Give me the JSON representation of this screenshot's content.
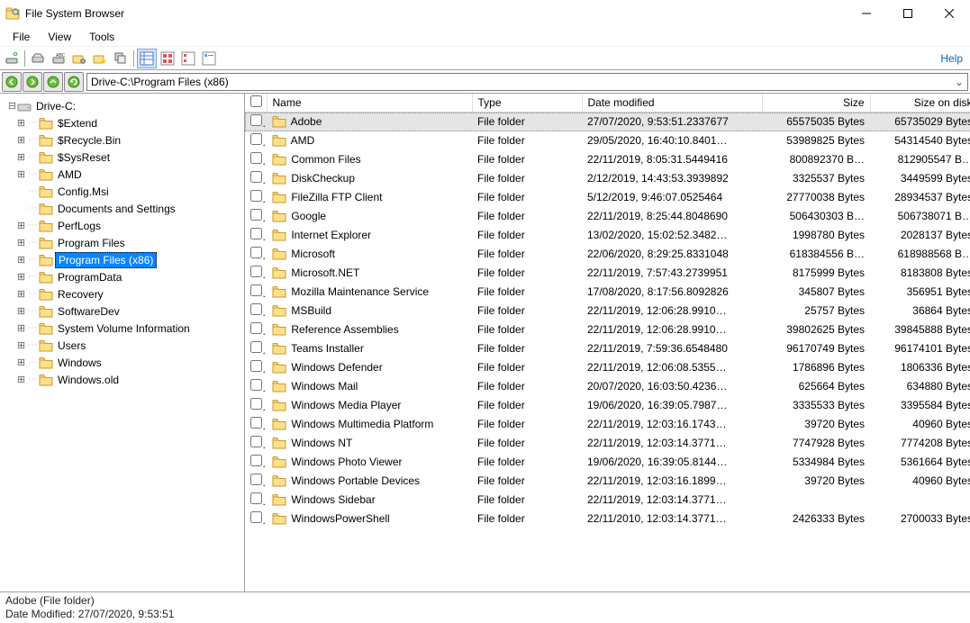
{
  "window": {
    "title": "File System Browser"
  },
  "menubar": [
    "File",
    "View",
    "Tools"
  ],
  "help_label": "Help",
  "path": "Drive-C:\\Program Files (x86)",
  "tree": {
    "root": {
      "label": "Drive-C:",
      "expanded": true,
      "icon": "drive"
    },
    "children": [
      {
        "label": "$Extend",
        "hasChildren": true
      },
      {
        "label": "$Recycle.Bin",
        "hasChildren": true
      },
      {
        "label": "$SysReset",
        "hasChildren": true
      },
      {
        "label": "AMD",
        "hasChildren": true
      },
      {
        "label": "Config.Msi",
        "hasChildren": false
      },
      {
        "label": "Documents and Settings",
        "hasChildren": false
      },
      {
        "label": "PerfLogs",
        "hasChildren": true
      },
      {
        "label": "Program Files",
        "hasChildren": true
      },
      {
        "label": "Program Files (x86)",
        "hasChildren": true,
        "selected": true
      },
      {
        "label": "ProgramData",
        "hasChildren": true
      },
      {
        "label": "Recovery",
        "hasChildren": true
      },
      {
        "label": "SoftwareDev",
        "hasChildren": true
      },
      {
        "label": "System Volume Information",
        "hasChildren": true
      },
      {
        "label": "Users",
        "hasChildren": true
      },
      {
        "label": "Windows",
        "hasChildren": true
      },
      {
        "label": "Windows.old",
        "hasChildren": true
      }
    ]
  },
  "columns": [
    "Name",
    "Type",
    "Date modified",
    "Size",
    "Size on disk"
  ],
  "rows": [
    {
      "name": "Adobe",
      "type": "File folder",
      "date": "27/07/2020, 9:53:51.2337677",
      "size": "65575035 Bytes",
      "disk": "65735029 Bytes",
      "selected": true
    },
    {
      "name": "AMD",
      "type": "File folder",
      "date": "29/05/2020, 16:40:10.8401…",
      "size": "53989825 Bytes",
      "disk": "54314540 Bytes"
    },
    {
      "name": "Common Files",
      "type": "File folder",
      "date": "22/11/2019, 8:05:31.5449416",
      "size": "800892370 B…",
      "disk": "812905547 B…"
    },
    {
      "name": "DiskCheckup",
      "type": "File folder",
      "date": "2/12/2019, 14:43:53.3939892",
      "size": "3325537 Bytes",
      "disk": "3449599 Bytes"
    },
    {
      "name": "FileZilla FTP Client",
      "type": "File folder",
      "date": "5/12/2019, 9:46:07.0525464",
      "size": "27770038 Bytes",
      "disk": "28934537 Bytes"
    },
    {
      "name": "Google",
      "type": "File folder",
      "date": "22/11/2019, 8:25:44.8048690",
      "size": "506430303 B…",
      "disk": "506738071 B…"
    },
    {
      "name": "Internet Explorer",
      "type": "File folder",
      "date": "13/02/2020, 15:02:52.3482…",
      "size": "1998780 Bytes",
      "disk": "2028137 Bytes"
    },
    {
      "name": "Microsoft",
      "type": "File folder",
      "date": "22/06/2020, 8:29:25.8331048",
      "size": "618384556 B…",
      "disk": "618988568 B…"
    },
    {
      "name": "Microsoft.NET",
      "type": "File folder",
      "date": "22/11/2019, 7:57:43.2739951",
      "size": "8175999 Bytes",
      "disk": "8183808 Bytes"
    },
    {
      "name": "Mozilla Maintenance Service",
      "type": "File folder",
      "date": "17/08/2020, 8:17:56.8092826",
      "size": "345807 Bytes",
      "disk": "356951 Bytes"
    },
    {
      "name": "MSBuild",
      "type": "File folder",
      "date": "22/11/2019, 12:06:28.9910…",
      "size": "25757 Bytes",
      "disk": "36864 Bytes"
    },
    {
      "name": "Reference Assemblies",
      "type": "File folder",
      "date": "22/11/2019, 12:06:28.9910…",
      "size": "39802625 Bytes",
      "disk": "39845888 Bytes"
    },
    {
      "name": "Teams Installer",
      "type": "File folder",
      "date": "22/11/2019, 7:59:36.6548480",
      "size": "96170749 Bytes",
      "disk": "96174101 Bytes"
    },
    {
      "name": "Windows Defender",
      "type": "File folder",
      "date": "22/11/2019, 12:06:08.5355…",
      "size": "1786896 Bytes",
      "disk": "1806336 Bytes"
    },
    {
      "name": "Windows Mail",
      "type": "File folder",
      "date": "20/07/2020, 16:03:50.4236…",
      "size": "625664 Bytes",
      "disk": "634880 Bytes"
    },
    {
      "name": "Windows Media Player",
      "type": "File folder",
      "date": "19/06/2020, 16:39:05.7987…",
      "size": "3335533 Bytes",
      "disk": "3395584 Bytes"
    },
    {
      "name": "Windows Multimedia Platform",
      "type": "File folder",
      "date": "22/11/2019, 12:03:16.1743…",
      "size": "39720 Bytes",
      "disk": "40960 Bytes"
    },
    {
      "name": "Windows NT",
      "type": "File folder",
      "date": "22/11/2019, 12:03:14.3771…",
      "size": "7747928 Bytes",
      "disk": "7774208 Bytes"
    },
    {
      "name": "Windows Photo Viewer",
      "type": "File folder",
      "date": "19/06/2020, 16:39:05.8144…",
      "size": "5334984 Bytes",
      "disk": "5361664 Bytes"
    },
    {
      "name": "Windows Portable Devices",
      "type": "File folder",
      "date": "22/11/2019, 12:03:16.1899…",
      "size": "39720 Bytes",
      "disk": "40960 Bytes"
    },
    {
      "name": "Windows Sidebar",
      "type": "File folder",
      "date": "22/11/2019, 12:03:14.3771…",
      "size": "",
      "disk": ""
    },
    {
      "name": "WindowsPowerShell",
      "type": "File folder",
      "date": "22/11/2010, 12:03:14.3771…",
      "size": "2426333 Bytes",
      "disk": "2700033 Bytes"
    }
  ],
  "status": {
    "line1": "Adobe (File folder)",
    "line2": "Date Modified: 27/07/2020, 9:53:51"
  }
}
